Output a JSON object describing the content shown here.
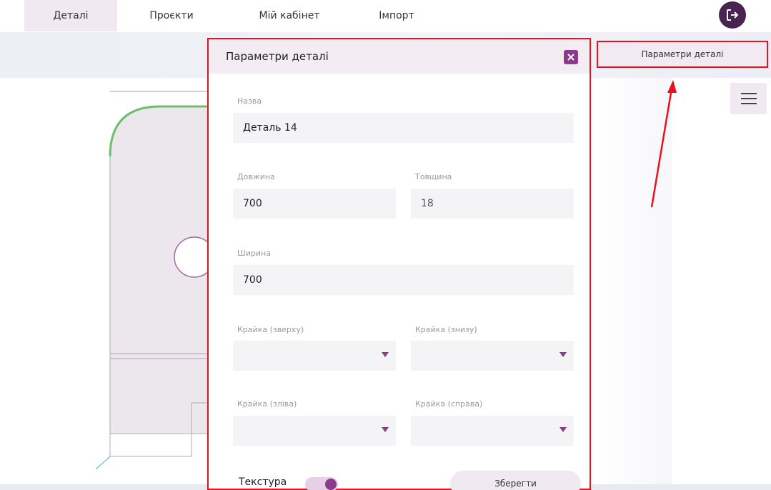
{
  "topnav": {
    "tabs": [
      {
        "label": "Деталі",
        "active": true
      },
      {
        "label": "Проєкти",
        "active": false
      },
      {
        "label": "Мій кабінет",
        "active": false
      },
      {
        "label": "Імпорт",
        "active": false
      }
    ]
  },
  "toolbar": {
    "part_params_button": "Параметри деталі"
  },
  "modal": {
    "title": "Параметри деталі",
    "fields": {
      "name": {
        "label": "Назва",
        "value": "Деталь 14"
      },
      "length": {
        "label": "Довжина",
        "value": "700"
      },
      "thickness": {
        "label": "Товщина",
        "value": "18"
      },
      "width": {
        "label": "Ширина",
        "value": "700"
      },
      "edge_top": {
        "label": "Крайка (зверху)",
        "value": ""
      },
      "edge_bottom": {
        "label": "Крайка (знизу)",
        "value": ""
      },
      "edge_left": {
        "label": "Крайка (зліва)",
        "value": ""
      },
      "edge_right": {
        "label": "Крайка (справа)",
        "value": ""
      }
    },
    "texture_label": "Текстура",
    "texture_enabled": true,
    "save_label": "Зберегти"
  },
  "colors": {
    "accent": "#8c3a8c",
    "highlight": "#e8121c",
    "logout": "#4a2450",
    "edge_band": "#6cbf6c"
  }
}
